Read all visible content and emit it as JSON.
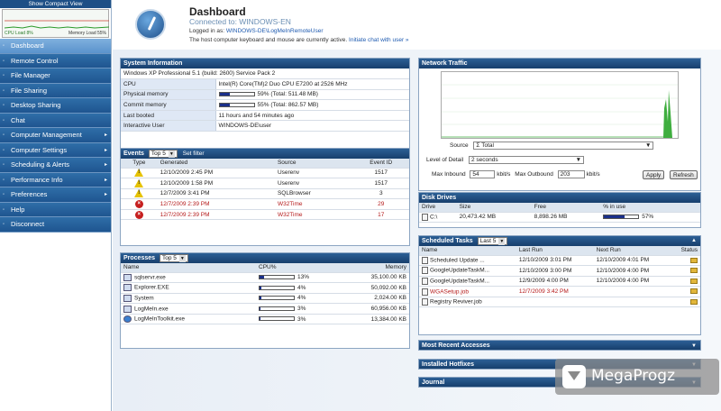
{
  "sidebar": {
    "compact_view": "Show Compact View",
    "cpu_label": "CPU Load 8%",
    "mem_label": "Memory Load 55%",
    "items": [
      {
        "label": "Dashboard",
        "arrow": "",
        "active": true
      },
      {
        "label": "Remote Control",
        "arrow": ""
      },
      {
        "label": "File Manager",
        "arrow": ""
      },
      {
        "label": "File Sharing",
        "arrow": ""
      },
      {
        "label": "Desktop Sharing",
        "arrow": ""
      },
      {
        "label": "Chat",
        "arrow": ""
      },
      {
        "label": "Computer Management",
        "arrow": "▸"
      },
      {
        "label": "Computer Settings",
        "arrow": "▸"
      },
      {
        "label": "Scheduling & Alerts",
        "arrow": "▸"
      },
      {
        "label": "Performance Info",
        "arrow": "▸"
      },
      {
        "label": "Preferences",
        "arrow": "▸"
      },
      {
        "label": "Help",
        "arrow": ""
      },
      {
        "label": "Disconnect",
        "arrow": ""
      }
    ]
  },
  "header": {
    "title": "Dashboard",
    "connected": "Connected to: WINDOWS-EN",
    "logged_prefix": "Logged in as: ",
    "logged_user": "WINDOWS-DE\\LogMeInRemoteUser",
    "kb_text": "The host computer keyboard and mouse are currently active. ",
    "kb_link": "Initiate chat with user »"
  },
  "system_info": {
    "title": "System Information",
    "os": "Windows XP Professional 5.1 (build: 2600) Service Pack 2",
    "rows": [
      {
        "key": "CPU",
        "value": "Intel(R) Core(TM)2 Duo CPU E7200 at 2526 MHz"
      },
      {
        "key": "Physical memory",
        "value": "59% (Total: 511.48 MB)",
        "bar": 0.59
      },
      {
        "key": "Commit memory",
        "value": "55% (Total: 862.57 MB)",
        "bar": 0.55
      },
      {
        "key": "Last booted",
        "value": "11 hours and 54 minutes ago"
      },
      {
        "key": "Interactive User",
        "value": "WINDOWS-DE\\user"
      }
    ]
  },
  "events": {
    "title": "Events",
    "filter": "Top 5",
    "set_filter": "Set filter",
    "columns": [
      "Type",
      "Generated",
      "Source",
      "Event ID"
    ],
    "rows": [
      {
        "type": "warning",
        "generated": "12/10/2009 2:45 PM",
        "source": "Userenv",
        "id": "1517",
        "error": false
      },
      {
        "type": "warning",
        "generated": "12/10/2009 1:58 PM",
        "source": "Userenv",
        "id": "1517",
        "error": false
      },
      {
        "type": "warning",
        "generated": "12/7/2009 3:41 PM",
        "source": "SQLBrowser",
        "id": "3",
        "error": false
      },
      {
        "type": "error",
        "generated": "12/7/2009 2:39 PM",
        "source": "W32Time",
        "id": "29",
        "error": true
      },
      {
        "type": "error",
        "generated": "12/7/2009 2:39 PM",
        "source": "W32Time",
        "id": "17",
        "error": true
      }
    ]
  },
  "processes": {
    "title": "Processes",
    "filter": "Top 5",
    "columns": [
      "Name",
      "CPU%",
      "Memory"
    ],
    "rows": [
      {
        "name": "sqlservr.exe",
        "cpu": "13%",
        "cpu_frac": 0.13,
        "memory": "35,100.00 KB",
        "icon": "box"
      },
      {
        "name": "Explorer.EXE",
        "cpu": "4%",
        "cpu_frac": 0.04,
        "memory": "50,092.00 KB",
        "icon": "box"
      },
      {
        "name": "System",
        "cpu": "4%",
        "cpu_frac": 0.04,
        "memory": "2,024.00 KB",
        "icon": "box"
      },
      {
        "name": "LogMeIn.exe",
        "cpu": "3%",
        "cpu_frac": 0.03,
        "memory": "60,956.00 KB",
        "icon": "box"
      },
      {
        "name": "LogMeInToolkit.exe",
        "cpu": "3%",
        "cpu_frac": 0.03,
        "memory": "13,384.00 KB",
        "icon": "circle"
      }
    ]
  },
  "network": {
    "title": "Network Traffic",
    "source_label": "Source",
    "source_value": "Σ Total",
    "lod_label": "Level of Detail",
    "lod_value": "2 seconds",
    "max_in_label": "Max Inbound",
    "max_in_value": "54",
    "max_out_label": "Max Outbound",
    "max_out_value": "203",
    "unit": "kbit/s",
    "apply": "Apply",
    "refresh": "Refresh"
  },
  "disk": {
    "title": "Disk Drives",
    "columns": [
      "Drive",
      "Size",
      "Free",
      "% in use"
    ],
    "rows": [
      {
        "drive": "C:\\",
        "size": "20,473.42 MB",
        "free": "8,898.26 MB",
        "use": "57%",
        "use_frac": 0.57
      }
    ]
  },
  "tasks": {
    "title": "Scheduled Tasks",
    "filter": "Last 5",
    "columns": [
      "Name",
      "Last Run",
      "Next Run",
      "Status"
    ],
    "rows": [
      {
        "name": "Scheduled Update ...",
        "last": "12/10/2009 3:01 PM",
        "next": "12/10/2009 4:01 PM",
        "error": false
      },
      {
        "name": "GoogleUpdateTaskM...",
        "last": "12/10/2009 3:00 PM",
        "next": "12/10/2009 4:00 PM",
        "error": false
      },
      {
        "name": "GoogleUpdateTaskM...",
        "last": "12/9/2009 4:00 PM",
        "next": "12/10/2009 4:00 PM",
        "error": false
      },
      {
        "name": "WGASetup.job",
        "last": "12/7/2009 3:42 PM",
        "next": "",
        "error": true
      },
      {
        "name": "Registry Reviver.job",
        "last": "",
        "next": "",
        "error": false
      }
    ]
  },
  "collapsed": {
    "recent": "Most Recent Accesses",
    "hotfixes": "Installed Hotfixes",
    "journal": "Journal"
  },
  "watermark": "MegaProgz"
}
